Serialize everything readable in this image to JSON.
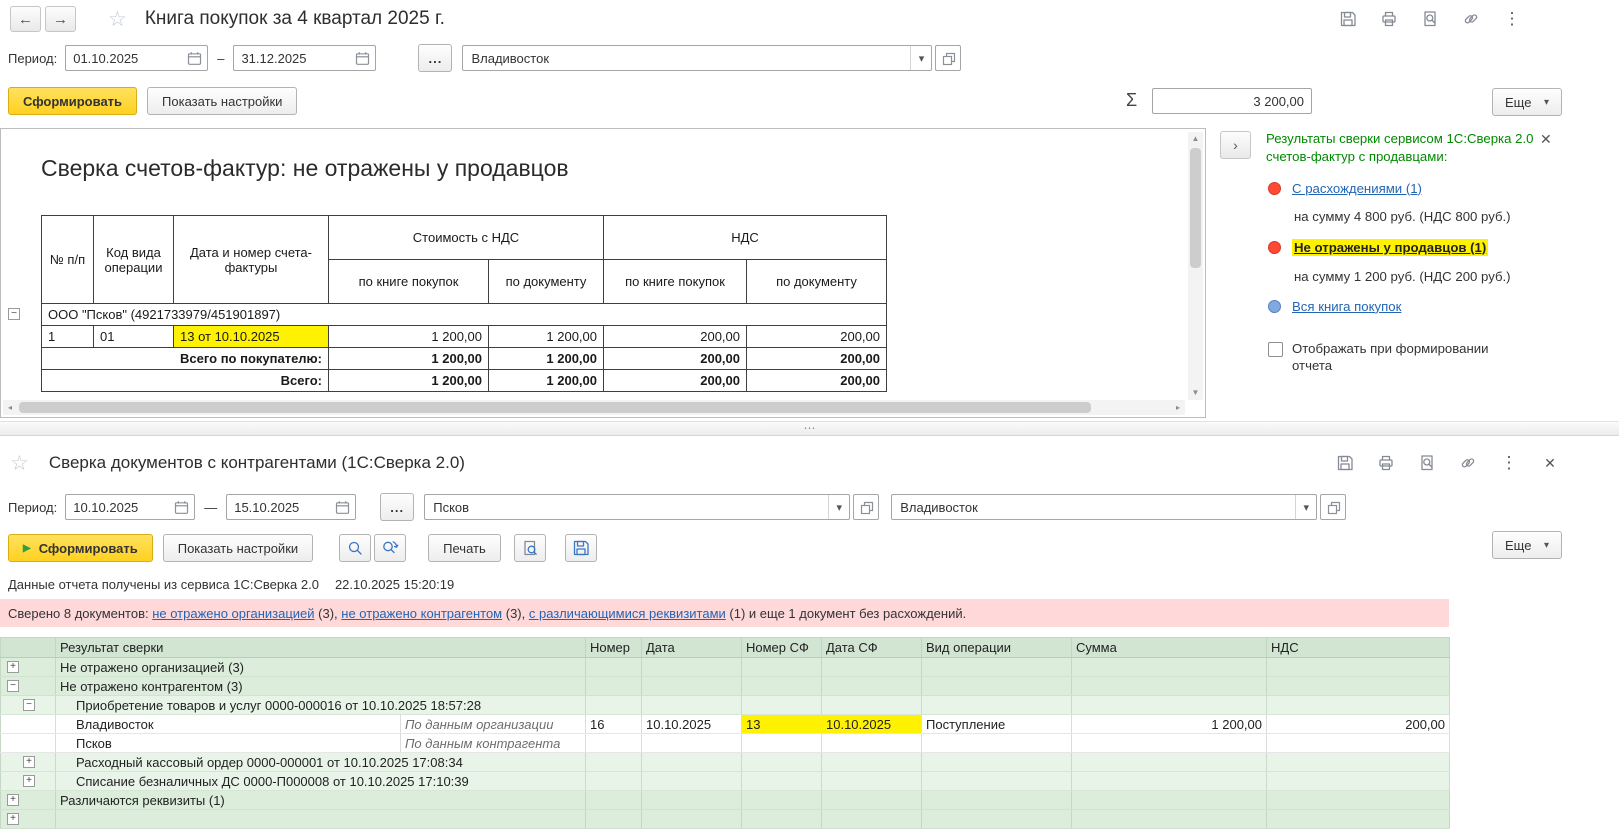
{
  "colors": {
    "highlight": "#FFF200",
    "link_blue": "#2265B5",
    "green_text": "#008A00",
    "banner_pink": "#FFD9D9",
    "status_red": "#FF4933",
    "status_blue": "#7FA9DF",
    "accent_yellow_1": "#FFE15E",
    "accent_yellow_2": "#FFD11F"
  },
  "icons": {
    "back": "←",
    "forward": "→",
    "star": "☆",
    "menu": "⋮",
    "close": "✕",
    "dropdown": "▾",
    "sigma": "Σ",
    "chevron_right": "›",
    "play": "▶",
    "up": "▲",
    "down": "▼",
    "scroll_left": "◂",
    "scroll_right": "▸",
    "minus": "−",
    "plus": "+",
    "splitter_dots": "⋯"
  },
  "top_panel": {
    "title": "Книга покупок за 4 квартал 2025 г.",
    "period": {
      "label": "Период:",
      "from": "01.10.2025",
      "dash": "–",
      "to": "31.12.2025",
      "more": "...",
      "organization": "Владивосток"
    },
    "actions": {
      "generate": "Сформировать",
      "settings": "Показать настройки",
      "sum": "3 200,00",
      "more": "Еще"
    },
    "report": {
      "heading": "Сверка счетов-фактур: не отражены у продавцов",
      "columns": {
        "num": "№ п/п",
        "op_code": "Код вида операции",
        "invoice": "Дата и номер счета-фактуры",
        "cost": "Стоимость с НДС",
        "vat": "НДС",
        "by_book": "по книге покупок",
        "by_doc": "по документу"
      },
      "group": "ООО \"Псков\" (4921733979/451901897)",
      "row": {
        "num": "1",
        "op_code": "01",
        "invoice": "13 от 10.10.2025",
        "cost_book": "1 200,00",
        "cost_doc": "1 200,00",
        "vat_book": "200,00",
        "vat_doc": "200,00"
      },
      "total_buyer": {
        "label": "Всего по покупателю:",
        "cost_book": "1 200,00",
        "cost_doc": "1 200,00",
        "vat_book": "200,00",
        "vat_doc": "200,00"
      },
      "total": {
        "label": "Всего:",
        "cost_book": "1 200,00",
        "cost_doc": "1 200,00",
        "vat_book": "200,00",
        "vat_doc": "200,00"
      }
    },
    "verify_panel": {
      "heading": "Результаты сверки сервисом 1С:Сверка 2.0 счетов-фактур с продавцами:",
      "discrepancies_link": "С расхождениями (1)",
      "discrepancies_sum": "на сумму 4 800 руб. (НДС 800 руб.)",
      "not_reflected_link": "Не отражены у продавцов (1)",
      "not_reflected_sum": "на сумму 1 200 руб. (НДС 200 руб.)",
      "whole_book_link": "Вся книга покупок",
      "checkbox_label": "Отображать при формировании отчета"
    }
  },
  "bottom_panel": {
    "title": "Сверка документов с контрагентами (1С:Сверка 2.0)",
    "period": {
      "label": "Период:",
      "from": "10.10.2025",
      "dash": "—",
      "to": "15.10.2025",
      "more": "...",
      "counterparty": "Псков",
      "organization": "Владивосток"
    },
    "actions": {
      "generate": "Сформировать",
      "settings": "Показать настройки",
      "print": "Печать",
      "more": "Еще"
    },
    "status": {
      "text": "Данные отчета получены из сервиса 1С:Сверка 2.0",
      "timestamp": "22.10.2025 15:20:19"
    },
    "banner": {
      "prefix": "Сверено 8 документов: ",
      "link_org": "не отражено организацией",
      "after_org": " (3), ",
      "link_cp": "не отражено контрагентом",
      "after_cp": " (3), ",
      "link_req": "с различающимися реквизитами",
      "after_req": " (1) и еще 1 документ без расхождений."
    },
    "table": {
      "headers": {
        "result": "Результат сверки",
        "number": "Номер",
        "date": "Дата",
        "invoice_number": "Номер СФ",
        "invoice_date": "Дата СФ",
        "operation": "Вид операции",
        "amount": "Сумма",
        "vat": "НДС"
      },
      "group_not_org": "Не отражено организацией (3)",
      "group_not_cp": "Не отражено контрагентом (3)",
      "doc_purchase": "Приобретение товаров и услуг 0000-000016 от 10.10.2025 18:57:28",
      "row_org": {
        "name": "Владивосток",
        "side": "По данным организации",
        "number": "16",
        "date": "10.10.2025",
        "invoice_number": "13",
        "invoice_date": "10.10.2025",
        "operation": "Поступление",
        "amount": "1 200,00",
        "vat": "200,00"
      },
      "row_cp": {
        "name": "Псков",
        "side": "По данным контрагента"
      },
      "doc_cash": "Расходный кассовый ордер 0000-000001 от 10.10.2025 17:08:34",
      "doc_writeoff": "Списание безналичных ДС 0000-П000008 от 10.10.2025 17:10:39",
      "group_diff": "Различаются реквизиты (1)"
    }
  }
}
